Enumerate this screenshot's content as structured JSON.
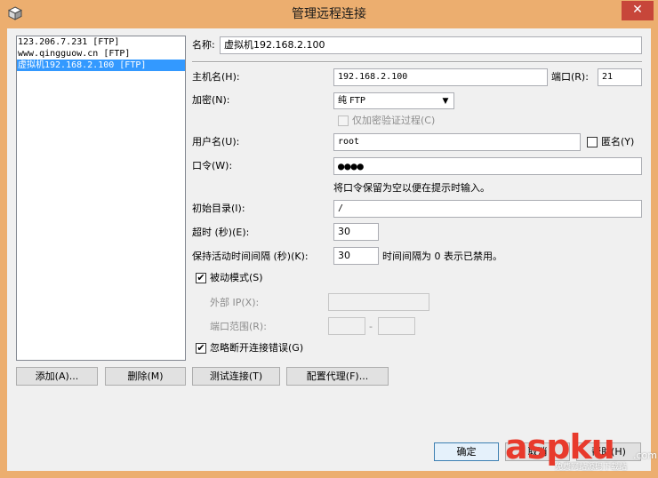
{
  "window": {
    "title": "管理远程连接",
    "close_glyph": "✕"
  },
  "connections": [
    {
      "label": "123.206.7.231 [FTP]",
      "selected": false
    },
    {
      "label": "www.qingguow.cn [FTP]",
      "selected": false
    },
    {
      "label": "虚拟机192.168.2.100 [FTP]",
      "selected": true
    }
  ],
  "form": {
    "name_label": "名称:",
    "name_value": "虚拟机192.168.2.100",
    "host_label": "主机名(H):",
    "host_value": "192.168.2.100",
    "port_label": "端口(R):",
    "port_value": "21",
    "encrypt_label": "加密(N):",
    "encrypt_value": "纯 FTP",
    "encrypt_only_auth_label": "仅加密验证过程(C)",
    "user_label": "用户名(U):",
    "user_value": "root",
    "anonymous_label": "匿名(Y)",
    "password_label": "口令(W):",
    "password_mask": "●●●●",
    "password_hint": "将口令保留为空以便在提示时输入。",
    "initdir_label": "初始目录(I):",
    "initdir_value": "/",
    "timeout_label": "超时 (秒)(E):",
    "timeout_value": "30",
    "keepalive_label": "保持活动时间间隔 (秒)(K):",
    "keepalive_value": "30",
    "keepalive_hint": "时间间隔为 0 表示已禁用。",
    "passive_label": "被动模式(S)",
    "passive_checked": true,
    "external_ip_label": "外部 IP(X):",
    "port_range_label": "端口范围(R):",
    "port_range_sep": "-",
    "ignore_errors_label": "忽略断开连接错误(G)",
    "ignore_errors_checked": true,
    "check_glyph": "✔"
  },
  "buttons": {
    "add": "添加(A)...",
    "delete": "删除(M)",
    "test": "测试连接(T)",
    "proxy": "配置代理(F)...",
    "ok": "确定",
    "cancel": "取消",
    "help": "帮助(H)"
  },
  "watermark": {
    "brand": "aspku",
    "domain": ".com",
    "tagline": "免费网站源码下载站"
  },
  "colors": {
    "title_bar": "#ecae6f",
    "close_button": "#c7463a",
    "selection": "#3399ff",
    "dialog_bg": "#f0f0f0",
    "watermark": "#e83a2c"
  }
}
